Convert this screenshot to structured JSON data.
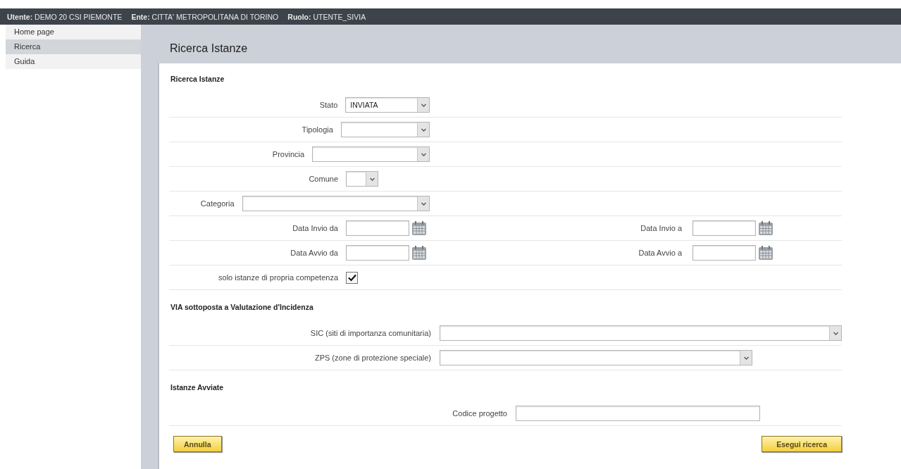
{
  "top_bar": [
    "**Utente:** DEMO 20 CSI PIEMONTE",
    "**Ente:** CITTA' METROPOLITANA DI TORINO",
    "**Ruolo:** UTENTE_SIVIA"
  ],
  "sidebar": {
    "items": [
      {
        "label": "Home page",
        "selected": false
      },
      {
        "label": "Ricerca",
        "selected": true
      },
      {
        "label": "Guida",
        "selected": false
      }
    ]
  },
  "page_title": "Ricerca Istanze",
  "sections": [
    {
      "kind": "search",
      "title": "Ricerca Istanze",
      "rows": [
        {
          "fields": [
            {
              "kind": "select",
              "label": "Stato",
              "value": "INVIATA"
            }
          ]
        },
        {
          "fields": [
            {
              "kind": "select",
              "label": "Tipologia"
            }
          ]
        },
        {
          "fields": [
            {
              "kind": "select",
              "label": "Provincia"
            }
          ]
        },
        {
          "fields": [
            {
              "kind": "select",
              "label": "Comune"
            }
          ]
        },
        {
          "fields": [
            {
              "kind": "select",
              "label": "Categoria"
            }
          ]
        },
        {
          "fields": [
            {
              "kind": "date",
              "label": "Data Invio da"
            },
            {
              "kind": "date",
              "label": "Data Invio a"
            }
          ]
        },
        {
          "fields": [
            {
              "kind": "date",
              "label": "Data Avvio da"
            },
            {
              "kind": "date",
              "label": "Data Avvio a"
            }
          ]
        },
        {
          "fields": [
            {
              "kind": "checkbox",
              "label": "solo istanze di propria competenza",
              "checked": true
            }
          ]
        }
      ]
    },
    {
      "kind": "via",
      "title": "VIA sottoposta a Valutazione d'Incidenza",
      "rows": [
        {
          "fields": [
            {
              "kind": "select",
              "label": "SIC (siti di importanza comunitaria)"
            }
          ]
        },
        {
          "fields": [
            {
              "kind": "select",
              "label": "ZPS (zone di protezione speciale)"
            }
          ]
        }
      ]
    },
    {
      "kind": "avviate",
      "title": "Istanze Avviate",
      "rows": [
        {
          "fields": [
            {
              "kind": "text",
              "label": "Codice progetto"
            }
          ]
        }
      ]
    }
  ],
  "buttons": [
    {
      "label": "Annulla"
    },
    {
      "label": "Esegui ricerca"
    }
  ]
}
